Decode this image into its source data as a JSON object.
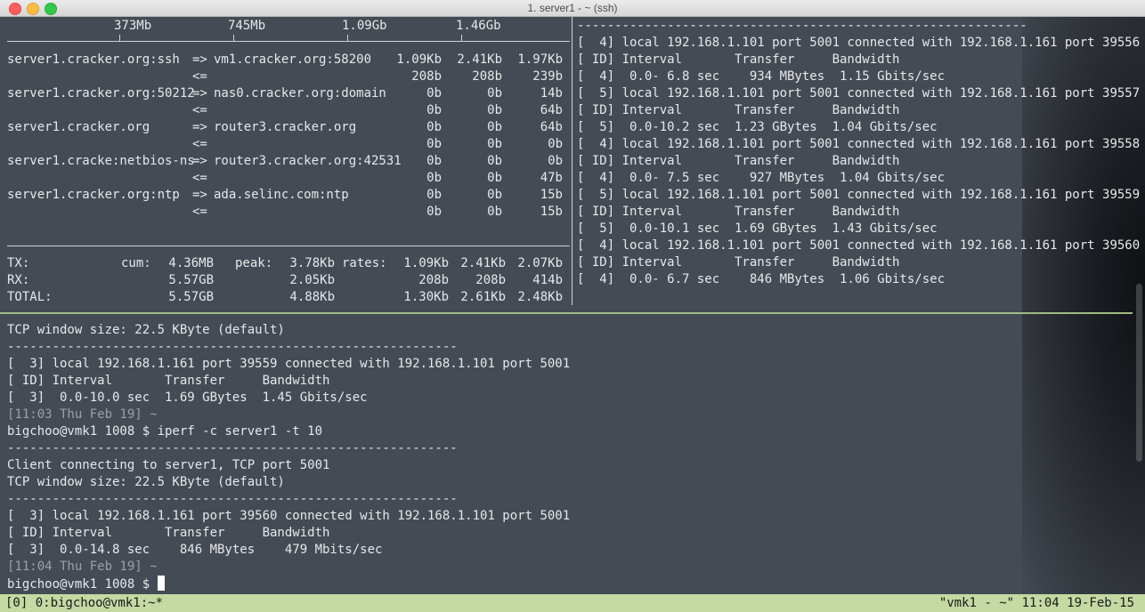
{
  "window": {
    "title": "1. server1 - ~ (ssh)"
  },
  "iftop": {
    "scale": [
      "373Mb",
      "745Mb",
      "1.09Gb",
      "1.46Gb"
    ],
    "flows": [
      {
        "src": "server1.cracker.org:ssh",
        "dir_out": "=>",
        "dst": "vm1.cracker.org:58200",
        "out": [
          "1.09Kb",
          "2.41Kb",
          "1.97Kb"
        ],
        "dir_in": "<=",
        "in": [
          "208b",
          "208b",
          "239b"
        ]
      },
      {
        "src": "server1.cracker.org:50212",
        "dir_out": "=>",
        "dst": "nas0.cracker.org:domain",
        "out": [
          "0b",
          "0b",
          "14b"
        ],
        "dir_in": "<=",
        "in": [
          "0b",
          "0b",
          "64b"
        ]
      },
      {
        "src": "server1.cracker.org",
        "dir_out": "=>",
        "dst": "router3.cracker.org",
        "out": [
          "0b",
          "0b",
          "64b"
        ],
        "dir_in": "<=",
        "in": [
          "0b",
          "0b",
          "0b"
        ]
      },
      {
        "src": "server1.cracke:netbios-ns",
        "dir_out": "=>",
        "dst": "router3.cracker.org:42531",
        "out": [
          "0b",
          "0b",
          "0b"
        ],
        "dir_in": "<=",
        "in": [
          "0b",
          "0b",
          "47b"
        ]
      },
      {
        "src": "server1.cracker.org:ntp",
        "dir_out": "=>",
        "dst": "ada.selinc.com:ntp",
        "out": [
          "0b",
          "0b",
          "15b"
        ],
        "dir_in": "<=",
        "in": [
          "0b",
          "0b",
          "15b"
        ]
      }
    ],
    "totals": {
      "tx": {
        "label": "TX:",
        "cum_label": "cum:",
        "cum": "4.36MB",
        "peak_label": "peak:",
        "peak": "3.78Kb",
        "rates_label": "rates:",
        "rates": [
          "1.09Kb",
          "2.41Kb",
          "2.07Kb"
        ]
      },
      "rx": {
        "label": "RX:",
        "cum": "5.57GB",
        "peak": "2.05Kb",
        "rates": [
          "208b",
          "208b",
          "414b"
        ]
      },
      "total": {
        "label": "TOTAL:",
        "cum": "5.57GB",
        "peak": "4.88Kb",
        "rates": [
          "1.30Kb",
          "2.61Kb",
          "2.48Kb"
        ]
      }
    }
  },
  "server_log": [
    "[  4] local 192.168.1.101 port 5001 connected with 192.168.1.161 port 39556",
    "[ ID] Interval       Transfer     Bandwidth",
    "[  4]  0.0- 6.8 sec    934 MBytes  1.15 Gbits/sec",
    "[  5] local 192.168.1.101 port 5001 connected with 192.168.1.161 port 39557",
    "[ ID] Interval       Transfer     Bandwidth",
    "[  5]  0.0-10.2 sec  1.23 GBytes  1.04 Gbits/sec",
    "[  4] local 192.168.1.101 port 5001 connected with 192.168.1.161 port 39558",
    "[ ID] Interval       Transfer     Bandwidth",
    "[  4]  0.0- 7.5 sec    927 MBytes  1.04 Gbits/sec",
    "[  5] local 192.168.1.101 port 5001 connected with 192.168.1.161 port 39559",
    "[ ID] Interval       Transfer     Bandwidth",
    "[  5]  0.0-10.1 sec  1.69 GBytes  1.43 Gbits/sec",
    "[  4] local 192.168.1.101 port 5001 connected with 192.168.1.161 port 39560",
    "[ ID] Interval       Transfer     Bandwidth",
    "[  4]  0.0- 6.7 sec    846 MBytes  1.06 Gbits/sec"
  ],
  "server_header": "------------------------------------------------------------",
  "client": {
    "window_size": "TCP window size: 22.5 KByte (default)",
    "dashes": "------------------------------------------------------------",
    "run1": [
      "[  3] local 192.168.1.161 port 39559 connected with 192.168.1.101 port 5001",
      "[ ID] Interval       Transfer     Bandwidth",
      "[  3]  0.0-10.0 sec  1.69 GBytes  1.45 Gbits/sec"
    ],
    "ts1": "[11:03 Thu Feb 19] ~",
    "prompt1": "bigchoo@vmk1 1008 $ ",
    "command1": "iperf -c server1 -t 10",
    "connecting": "Client connecting to server1, TCP port 5001",
    "run2": [
      "[  3] local 192.168.1.161 port 39560 connected with 192.168.1.101 port 5001",
      "[ ID] Interval       Transfer     Bandwidth",
      "[  3]  0.0-14.8 sec    846 MBytes    479 Mbits/sec"
    ],
    "ts2": "[11:04 Thu Feb 19] ~",
    "prompt2": "bigchoo@vmk1 1008 $ "
  },
  "tmux": {
    "left": "[0] 0:bigchoo@vmk1:~*",
    "host": "\"vmk1 - ~\"",
    "time": "11:04 19-Feb-15"
  }
}
